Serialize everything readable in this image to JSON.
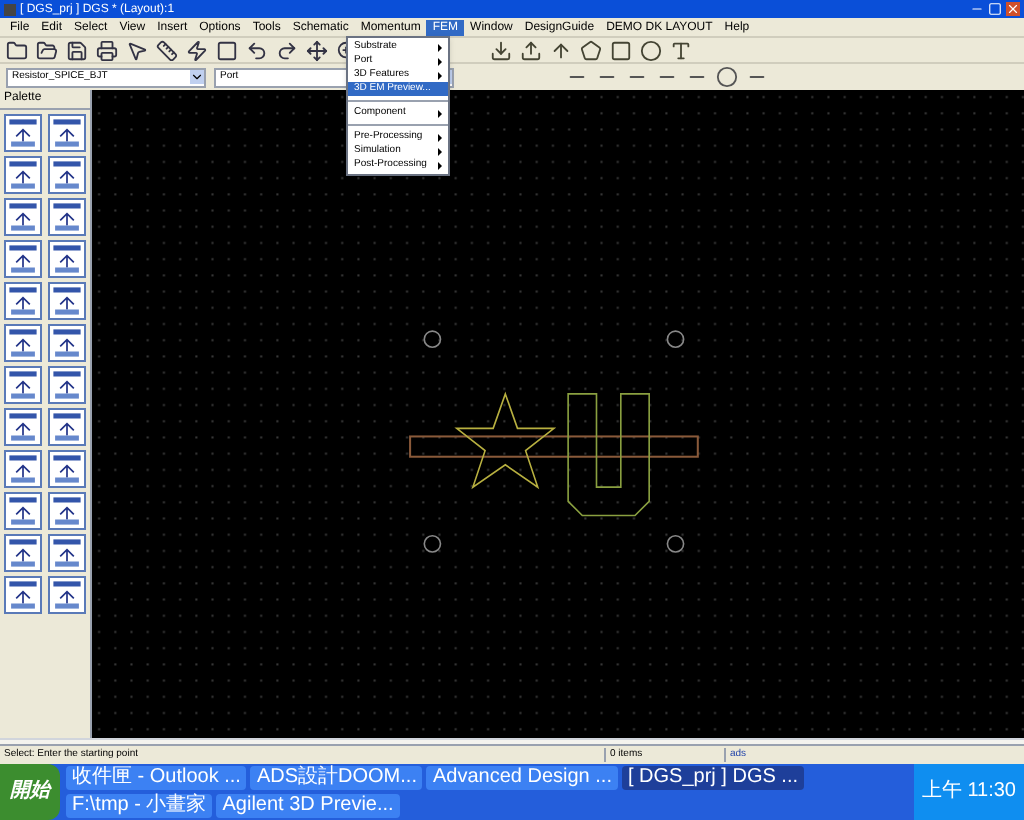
{
  "window": {
    "title": "[ DGS_prj ] DGS * (Layout):1"
  },
  "menu_bar": [
    {
      "label": "File",
      "selected": false
    },
    {
      "label": "Edit",
      "selected": false
    },
    {
      "label": "Select",
      "selected": false
    },
    {
      "label": "View",
      "selected": false
    },
    {
      "label": "Insert",
      "selected": false
    },
    {
      "label": "Options",
      "selected": false
    },
    {
      "label": "Tools",
      "selected": false
    },
    {
      "label": "Schematic",
      "selected": false
    },
    {
      "label": "Momentum",
      "selected": false
    },
    {
      "label": "FEM",
      "selected": true
    },
    {
      "label": "Window",
      "selected": false
    },
    {
      "label": "DesignGuide",
      "selected": false
    },
    {
      "label": "DEMO DK LAYOUT",
      "selected": false
    },
    {
      "label": "Help",
      "selected": false
    }
  ],
  "fem_menu": [
    {
      "kind": "item",
      "label": "Substrate",
      "submenu": true,
      "selected": false
    },
    {
      "kind": "item",
      "label": "Port",
      "submenu": true,
      "selected": false
    },
    {
      "kind": "item",
      "label": "3D Features",
      "submenu": true,
      "selected": false
    },
    {
      "kind": "item",
      "label": "3D EM Preview...",
      "submenu": false,
      "selected": true
    },
    {
      "kind": "separator"
    },
    {
      "kind": "item",
      "label": "Component",
      "submenu": true,
      "selected": false
    },
    {
      "kind": "separator"
    },
    {
      "kind": "item",
      "label": "Pre-Processing",
      "submenu": true,
      "selected": false
    },
    {
      "kind": "item",
      "label": "Simulation",
      "submenu": true,
      "selected": false
    },
    {
      "kind": "item",
      "label": "Post-Processing",
      "submenu": true,
      "selected": false
    }
  ],
  "toolbar2": {
    "library": "Resistor_SPICE_BJT",
    "component": "Port"
  },
  "palette": {
    "title": "Palette"
  },
  "status_bar": {
    "message": "Select: Enter the starting point",
    "items": "0 items",
    "layer": "ads"
  },
  "taskbar": {
    "start": "開始",
    "tasks": [
      {
        "label": "收件匣 - Outlook ...",
        "selected": false
      },
      {
        "label": "ADS設計DOOM...",
        "selected": false
      },
      {
        "label": "Advanced Design ...",
        "selected": false
      },
      {
        "label": "[ DGS_prj ] DGS ...",
        "selected": true
      },
      {
        "label": "F:\\tmp - 小畫家",
        "selected": false
      },
      {
        "label": "Agilent 3D Previe...",
        "selected": false
      }
    ],
    "clock": "上午 11:30"
  }
}
